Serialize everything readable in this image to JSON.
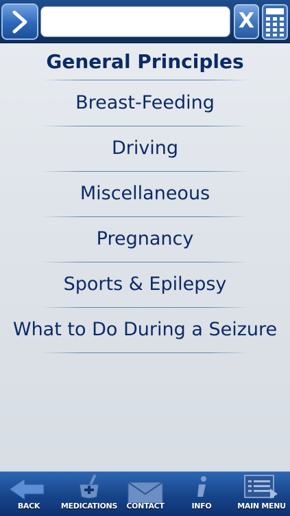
{
  "search": {
    "value": "",
    "placeholder": ""
  },
  "clear_label": "X",
  "section_title": "General Principles",
  "items": [
    {
      "label": "Breast-Feeding"
    },
    {
      "label": "Driving"
    },
    {
      "label": "Miscellaneous"
    },
    {
      "label": "Pregnancy"
    },
    {
      "label": "Sports & Epilepsy"
    },
    {
      "label": "What to Do During a Seizure"
    }
  ],
  "tabs": [
    {
      "label": "BACK",
      "icon": "back-arrow-icon"
    },
    {
      "label": "MEDICATIONS",
      "icon": "mortar-pestle-icon"
    },
    {
      "label": "CONTACT",
      "icon": "envelope-icon"
    },
    {
      "label": "INFO",
      "icon": "info-icon"
    },
    {
      "label": "MAIN MENU",
      "icon": "menu-list-icon"
    }
  ],
  "colors": {
    "accent": "#0c2a66",
    "bar": "#16448a",
    "background": "#dfe4ea"
  }
}
